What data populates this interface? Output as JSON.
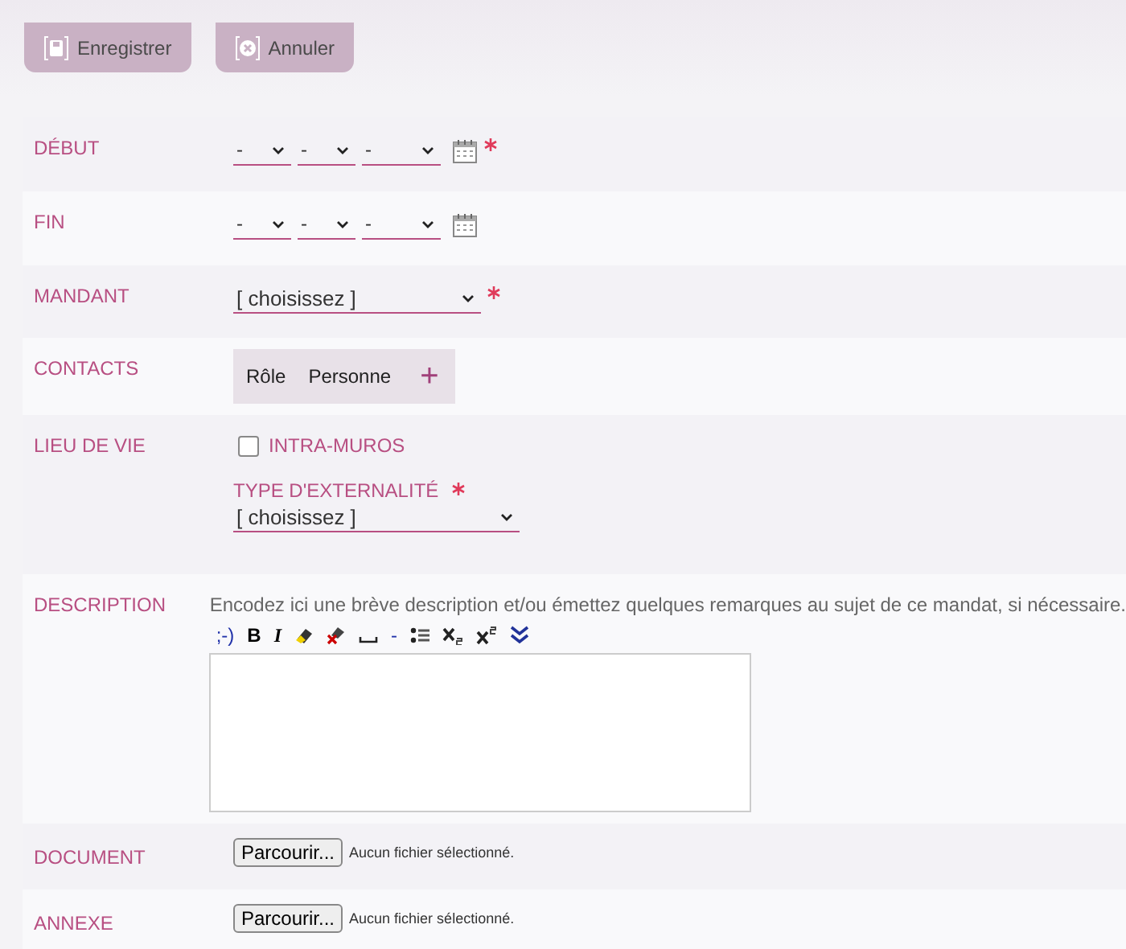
{
  "buttons": [
    {
      "kind": "save",
      "label": "Enregistrer"
    },
    {
      "kind": "cancel",
      "label": "Annuler"
    }
  ],
  "rows": [
    {
      "kind": "date",
      "label": "DÉBUT",
      "required": true,
      "parts": [
        "-",
        "-",
        "-"
      ]
    },
    {
      "kind": "date",
      "label": "FIN",
      "required": false,
      "parts": [
        "-",
        "-",
        "-"
      ]
    },
    {
      "kind": "select",
      "label": "MANDANT",
      "required": true,
      "value": "[ choisissez ]"
    },
    {
      "kind": "contacts",
      "label": "CONTACTS",
      "columns": [
        "Rôle",
        "Personne"
      ],
      "add": "+"
    },
    {
      "kind": "lieu",
      "label": "LIEU DE VIE",
      "checkbox": {
        "label": "INTRA-MUROS",
        "checked": false
      },
      "sublabel": "TYPE D'EXTERNALITÉ",
      "required": true,
      "value": "[ choisissez ]"
    },
    {
      "kind": "description",
      "label": "DESCRIPTION",
      "hint": "Encodez ici une brève description et/ou émettez quelques remarques au sujet de ce mandat, si nécessaire.",
      "toolbar": [
        {
          "kind": "text",
          "text": ";-)"
        },
        {
          "kind": "bold",
          "text": "B"
        },
        {
          "kind": "italic",
          "text": "I"
        },
        {
          "kind": "highlight"
        },
        {
          "kind": "erase"
        },
        {
          "kind": "space"
        },
        {
          "kind": "text",
          "text": "-"
        },
        {
          "kind": "list"
        },
        {
          "kind": "sub"
        },
        {
          "kind": "sup"
        },
        {
          "kind": "more"
        }
      ]
    },
    {
      "kind": "file",
      "label": "DOCUMENT",
      "button": "Parcourir...",
      "status": "Aucun fichier sélectionné."
    },
    {
      "kind": "file",
      "label": "ANNEXE",
      "button": "Parcourir...",
      "status": "Aucun fichier sélectionné."
    }
  ]
}
